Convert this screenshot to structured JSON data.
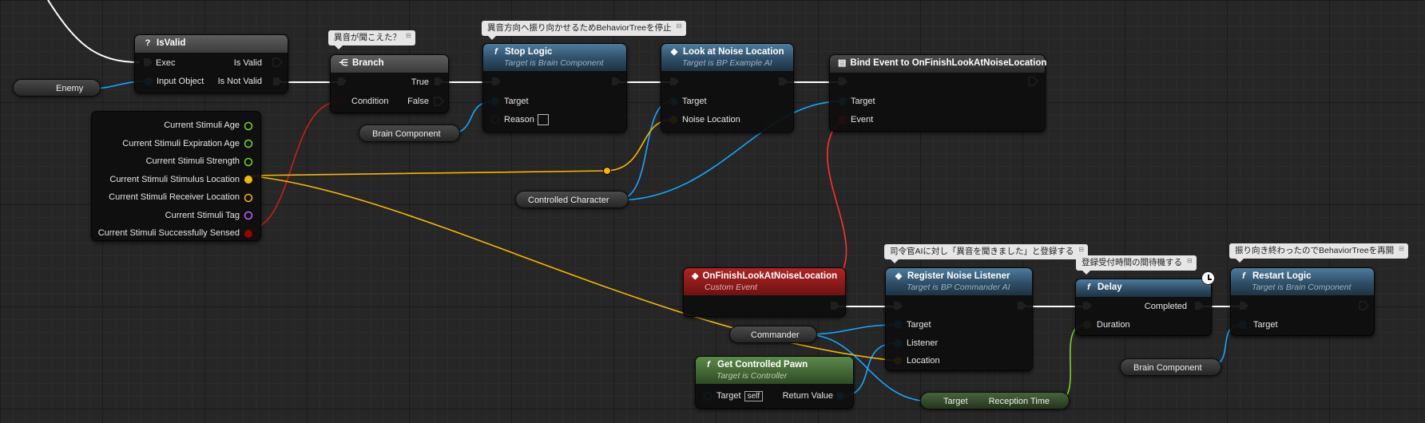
{
  "nodes": {
    "isvalid": {
      "title": "IsValid",
      "exec": "Exec",
      "input_object": "Input Object",
      "is_valid": "Is Valid",
      "is_not_valid": "Is Not Valid"
    },
    "branch": {
      "title": "Branch",
      "comment": "異音が聞こえた？",
      "true_label": "True",
      "false_label": "False",
      "condition": "Condition"
    },
    "stop_logic": {
      "title": "Stop Logic",
      "subtitle": "Target is Brain Component",
      "comment": "異音方向へ振り向かせるためBehaviorTreeを停止",
      "target": "Target",
      "reason": "Reason"
    },
    "look_at_noise": {
      "title": "Look at Noise Location",
      "subtitle": "Target is BP Example AI",
      "target": "Target",
      "noise_location": "Noise Location"
    },
    "bind_event": {
      "title": "Bind Event to OnFinishLookAtNoiseLocation",
      "target": "Target",
      "event": "Event"
    },
    "custom_event": {
      "title": "OnFinishLookAtNoiseLocation",
      "subtitle": "Custom Event"
    },
    "register_listener": {
      "title": "Register Noise Listener",
      "subtitle": "Target is BP Commander AI",
      "comment": "司令官AIに対し「異音を聞きました」と登録する",
      "target": "Target",
      "listener": "Listener",
      "location": "Location"
    },
    "delay": {
      "title": "Delay",
      "comment": "登録受付時間の間待機する",
      "completed": "Completed",
      "duration": "Duration"
    },
    "restart_logic": {
      "title": "Restart Logic",
      "subtitle": "Target is Brain Component",
      "comment": "振り向き終わったのでBehaviorTreeを再開",
      "target": "Target"
    },
    "get_pawn": {
      "title": "Get Controlled Pawn",
      "subtitle": "Target is Controller",
      "target": "Target",
      "self_label": "self",
      "return_value": "Return Value"
    },
    "stimulus": {
      "pins": [
        {
          "label": "Current Stimuli Age",
          "color": "#7ed321"
        },
        {
          "label": "Current Stimuli Expiration Age",
          "color": "#7ed321"
        },
        {
          "label": "Current Stimuli Strength",
          "color": "#7ed321"
        },
        {
          "label": "Current Stimuli Stimulus Location",
          "color": "#f5b800"
        },
        {
          "label": "Current Stimuli Receiver Location",
          "color": "#f5b800"
        },
        {
          "label": "Current Stimuli Tag",
          "color": "#c060ff"
        },
        {
          "label": "Current Stimuli Successfully Sensed",
          "color": "#9b0000"
        }
      ]
    }
  },
  "variables": {
    "enemy": "Enemy",
    "brain_component_1": "Brain Component",
    "controlled_character": "Controlled Character",
    "commander": "Commander",
    "brain_component_2": "Brain Component",
    "reception_time_target": "Target",
    "reception_time": "Reception Time"
  },
  "colors": {
    "exec": "#ffffff",
    "object": "#1aa6ff",
    "vector": "#f5b800",
    "bool": "#9b0000",
    "float": "#7ed321",
    "delegate": "#ff3030",
    "string": "#ff4fc8"
  }
}
